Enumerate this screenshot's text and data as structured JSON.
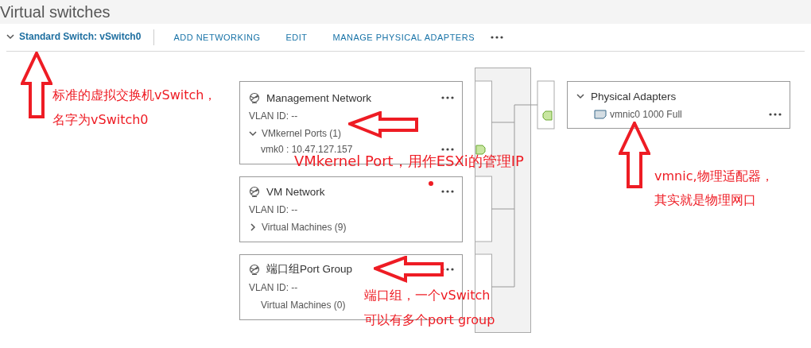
{
  "header": {
    "title": "Virtual switches"
  },
  "toolbar": {
    "switch": {
      "label": "Standard Switch: vSwitch0",
      "expanded": true
    },
    "actions": [
      "ADD NETWORKING",
      "EDIT",
      "MANAGE PHYSICAL ADAPTERS"
    ]
  },
  "port_groups": [
    {
      "name": "Management Network",
      "vlan": "VLAN ID: --",
      "section": {
        "label": "VMkernel Ports (1)",
        "expanded": true
      },
      "items": [
        "vmk0 : 10.47.127.157"
      ]
    },
    {
      "name": "VM Network",
      "vlan": "VLAN ID: --",
      "section": {
        "label": "Virtual Machines (9)",
        "expanded": false
      }
    },
    {
      "name": "端口组Port Group",
      "vlan": "VLAN ID: --",
      "section": {
        "label": "Virtual Machines (0)"
      }
    }
  ],
  "physical_adapters": {
    "title": "Physical Adapters",
    "expanded": true,
    "adapters": [
      "vmnic0 1000 Full"
    ]
  },
  "annotations": [
    {
      "kind": "up-arrow",
      "lines": [
        "标准的虚拟交换机vSwitch，",
        "名字为vSwitch0"
      ]
    },
    {
      "kind": "left-arrow",
      "lines": [
        "VMkernel Port，用作ESXi的管理IP"
      ]
    },
    {
      "kind": "left-arrow",
      "lines": [
        "端口组，一个vSwitch",
        "可以有多个port group"
      ]
    },
    {
      "kind": "up-arrow",
      "lines": [
        "vmnic,物理适配器，",
        "其实就是物理网口"
      ]
    },
    {
      "kind": "dot"
    }
  ]
}
